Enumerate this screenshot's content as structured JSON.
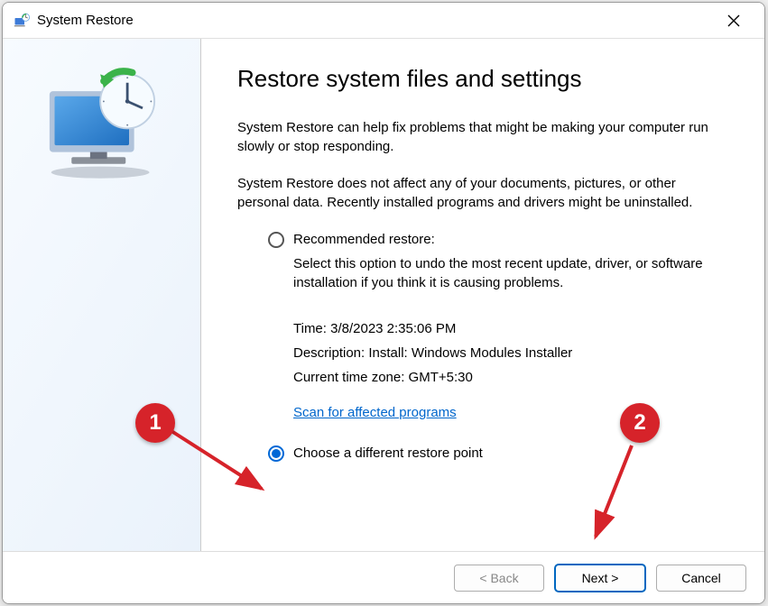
{
  "titlebar": {
    "title": "System Restore"
  },
  "content": {
    "heading": "Restore system files and settings",
    "paragraph1": "System Restore can help fix problems that might be making your computer run slowly or stop responding.",
    "paragraph2": "System Restore does not affect any of your documents, pictures, or other personal data. Recently installed programs and drivers might be uninstalled."
  },
  "options": {
    "recommended": {
      "label": "Recommended restore:",
      "description": "Select this option to undo the most recent update, driver, or software installation if you think it is causing problems.",
      "time": "Time: 3/8/2023 2:35:06 PM",
      "desc": "Description: Install: Windows Modules Installer",
      "tz": "Current time zone: GMT+5:30"
    },
    "scan_link": "Scan for affected programs",
    "choose_different": {
      "label": "Choose a different restore point"
    }
  },
  "footer": {
    "back": "< Back",
    "next": "Next >",
    "cancel": "Cancel"
  },
  "annotations": {
    "one": "1",
    "two": "2"
  }
}
